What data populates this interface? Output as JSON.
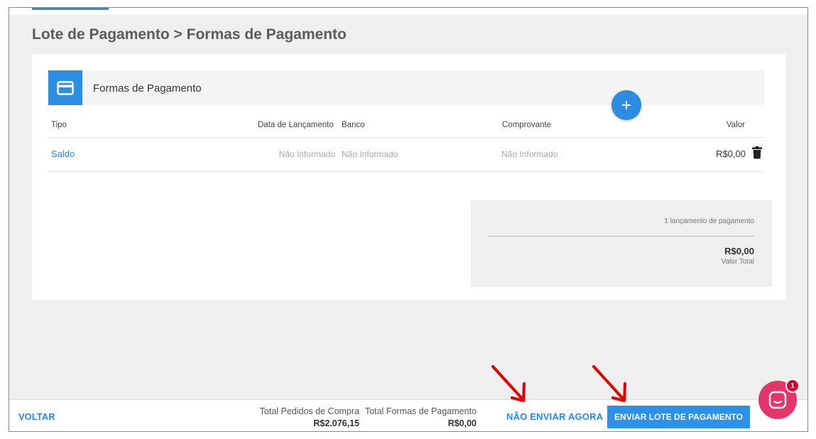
{
  "page_title": "Lote de Pagamento > Formas de Pagamento",
  "section": {
    "title": "Formas de Pagamento",
    "icon": "credit-card-icon",
    "add_icon": "plus-icon"
  },
  "table": {
    "columns": [
      "Tipo",
      "Data de Lançamento",
      "Banco",
      "Comprovante",
      "Valor"
    ],
    "rows": [
      {
        "tipo": "Saldo",
        "data": "Não Informado",
        "banco": "Não Informado",
        "comprovante": "Não Informado",
        "valor": "R$0,00",
        "action_icon": "trash-icon"
      }
    ]
  },
  "summary": {
    "count_text": "1 lançamento de pagamento",
    "total": "R$0,00",
    "total_label": "Valor Total"
  },
  "footer": {
    "back_label": "VOLTAR",
    "total_pedidos_label": "Total Pedidos de Compra",
    "total_pedidos_value": "R$2.076,15",
    "total_formas_label": "Total Formas de Pagamento",
    "total_formas_value": "R$0,00",
    "skip_label": "NÃO ENVIAR AGORA",
    "submit_label": "ENVIAR LOTE DE PAGAMENTO"
  },
  "chat": {
    "badge_count": "1",
    "icon": "chat-icon"
  },
  "colors": {
    "accent": "#2b8ce2",
    "link": "#2a88d9",
    "chat": "#e5366b",
    "annotation": "#e00000"
  }
}
